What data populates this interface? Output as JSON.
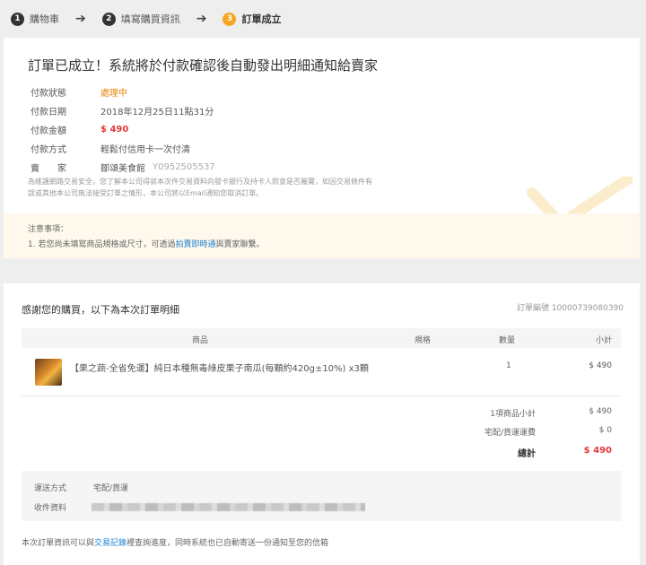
{
  "steps": [
    {
      "num": "1",
      "label": "購物車"
    },
    {
      "num": "2",
      "label": "填寫購買資訊"
    },
    {
      "num": "3",
      "label": "訂單成立"
    }
  ],
  "confirmation": {
    "title": "訂單已成立！系統將於付款確認後自動發出明細通知給賣家",
    "rows": [
      {
        "label": "付款狀態",
        "value": "處理中"
      },
      {
        "label": "付款日期",
        "value": "2018年12月25日11點31分"
      },
      {
        "label": "付款金額",
        "value": "$ 490"
      },
      {
        "label": "付款方式",
        "value": "輕鬆付信用卡一次付清"
      },
      {
        "label": "賣　　家",
        "value": "鄒頌美食館",
        "extra": "Y0952505537"
      }
    ],
    "notice_line1": "為維護網路交易安全，您了解本公司得就本次件交易資料向發卡銀行及持卡人照會是否屬實，如因交易條件有",
    "notice_line2": "誤或其他本公司無法接受訂單之情形，本公司將以Email通知您取消訂單。",
    "attention_title": "注意事項：",
    "attention_prefix": "1. 若您尚未填寫商品規格或尺寸，可透過",
    "attention_link": "拍賣即時通",
    "attention_suffix": "與賣家聯繫。"
  },
  "order": {
    "thanks": "感謝您的購買，以下為本次訂單明細",
    "order_number": "訂單編號 10000739080390",
    "headers": {
      "product": "商品",
      "spec": "規格",
      "qty": "數量",
      "subtotal": "小計"
    },
    "items": [
      {
        "name": "【果之蔬-全省免運】純日本種無毒綠皮栗子南瓜(每顆約420g±10%) x3顆",
        "qty": "1",
        "price": "$ 490"
      }
    ],
    "summary": [
      {
        "label": "1項商品小計",
        "value": "$ 490"
      },
      {
        "label": "宅配/貨運運費",
        "value": "$ 0"
      },
      {
        "label": "總計",
        "value": "$ 490"
      }
    ],
    "shipping_method_label": "運送方式",
    "shipping_method_value": "宅配/貨運",
    "recipient_label": "收件資料",
    "footer_prefix": "本次訂單資訊可以與",
    "footer_link": "交易記錄",
    "footer_suffix": "裡查詢進度，同時系統也已自動寄送一份通知至您的信箱"
  },
  "colors": {
    "accent": "#f5a623",
    "price": "#e23b3b",
    "link": "#1c82d2",
    "processing": "#e8860c"
  }
}
